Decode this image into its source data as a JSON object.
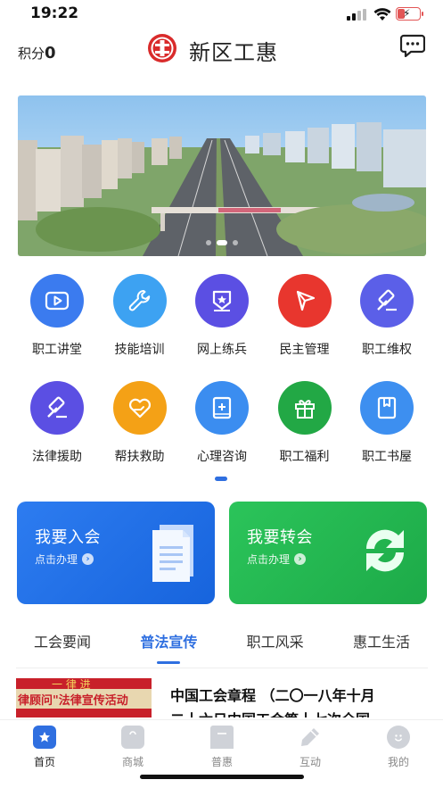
{
  "status_bar": {
    "time": "19:22"
  },
  "header": {
    "points_label": "积分",
    "points_value": "0",
    "title": "新区工惠"
  },
  "colors": {
    "accent": "#2f6fe0",
    "join_card": "#2d7cf0",
    "transfer_card": "#2bc45a"
  },
  "grid": [
    [
      {
        "label": "职工讲堂",
        "icon": "play-icon",
        "color": "#3b7bef"
      },
      {
        "label": "技能培训",
        "icon": "wrench-icon",
        "color": "#3da2f2"
      },
      {
        "label": "网上练兵",
        "icon": "award-icon",
        "color": "#5b4fe3"
      },
      {
        "label": "民主管理",
        "icon": "flag-icon",
        "color": "#e8362e"
      },
      {
        "label": "职工维权",
        "icon": "gavel-icon",
        "color": "#5b5fe8"
      }
    ],
    [
      {
        "label": "法律援助",
        "icon": "gavel-icon",
        "color": "#5b4fe3"
      },
      {
        "label": "帮扶救助",
        "icon": "heart-hand-icon",
        "color": "#f4a116"
      },
      {
        "label": "心理咨询",
        "icon": "book-plus-icon",
        "color": "#3b8df0"
      },
      {
        "label": "职工福利",
        "icon": "gift-icon",
        "color": "#22a845"
      },
      {
        "label": "职工书屋",
        "icon": "bookmark-icon",
        "color": "#3d8ff0"
      }
    ]
  ],
  "cards": {
    "join": {
      "title": "我要入会",
      "sub": "点击办理"
    },
    "transfer": {
      "title": "我要转会",
      "sub": "点击办理"
    }
  },
  "tabs": [
    {
      "label": "工会要闻",
      "active": false
    },
    {
      "label": "普法宣传",
      "active": true
    },
    {
      "label": "职工风采",
      "active": false
    },
    {
      "label": "惠工生活",
      "active": false
    }
  ],
  "news": {
    "thumb_text": "律顾问\"法律宣传活动",
    "thumb_top": "一 律 进",
    "title": "中国工会章程 （二〇一八年十月",
    "title_line2": "二十六日中国工会第十七次全国"
  },
  "bottom_nav": [
    {
      "label": "首页",
      "icon": "home-icon",
      "active": true
    },
    {
      "label": "商城",
      "icon": "bag-icon",
      "active": false
    },
    {
      "label": "普惠",
      "icon": "bookmark-icon",
      "active": false
    },
    {
      "label": "互动",
      "icon": "pen-icon",
      "active": false
    },
    {
      "label": "我的",
      "icon": "smile-icon",
      "active": false
    }
  ]
}
